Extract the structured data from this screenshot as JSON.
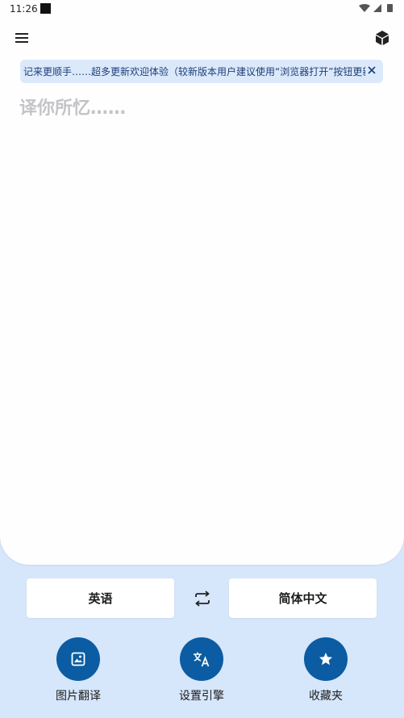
{
  "status_bar": {
    "time": "11:26"
  },
  "app_bar": {
    "menu_icon": "menu-icon",
    "cube_icon": "cube-icon"
  },
  "banner": {
    "text": "记来更顺手……超多更新欢迎体验（较新版本用户建议使用“浏览器打开”按钮更新）。",
    "close_icon": "close-icon"
  },
  "input": {
    "placeholder": "译你所忆……",
    "value": ""
  },
  "languages": {
    "source": "英语",
    "target": "简体中文",
    "swap_icon": "swap-icon"
  },
  "actions": [
    {
      "label": "图片翻译",
      "icon": "image-icon"
    },
    {
      "label": "设置引擎",
      "icon": "translate-icon"
    },
    {
      "label": "收藏夹",
      "icon": "star-icon"
    }
  ],
  "colors": {
    "accent": "#0b5ca2",
    "background": "#d6e6fb",
    "panel": "#fefeff",
    "banner": "#dce9fb"
  }
}
